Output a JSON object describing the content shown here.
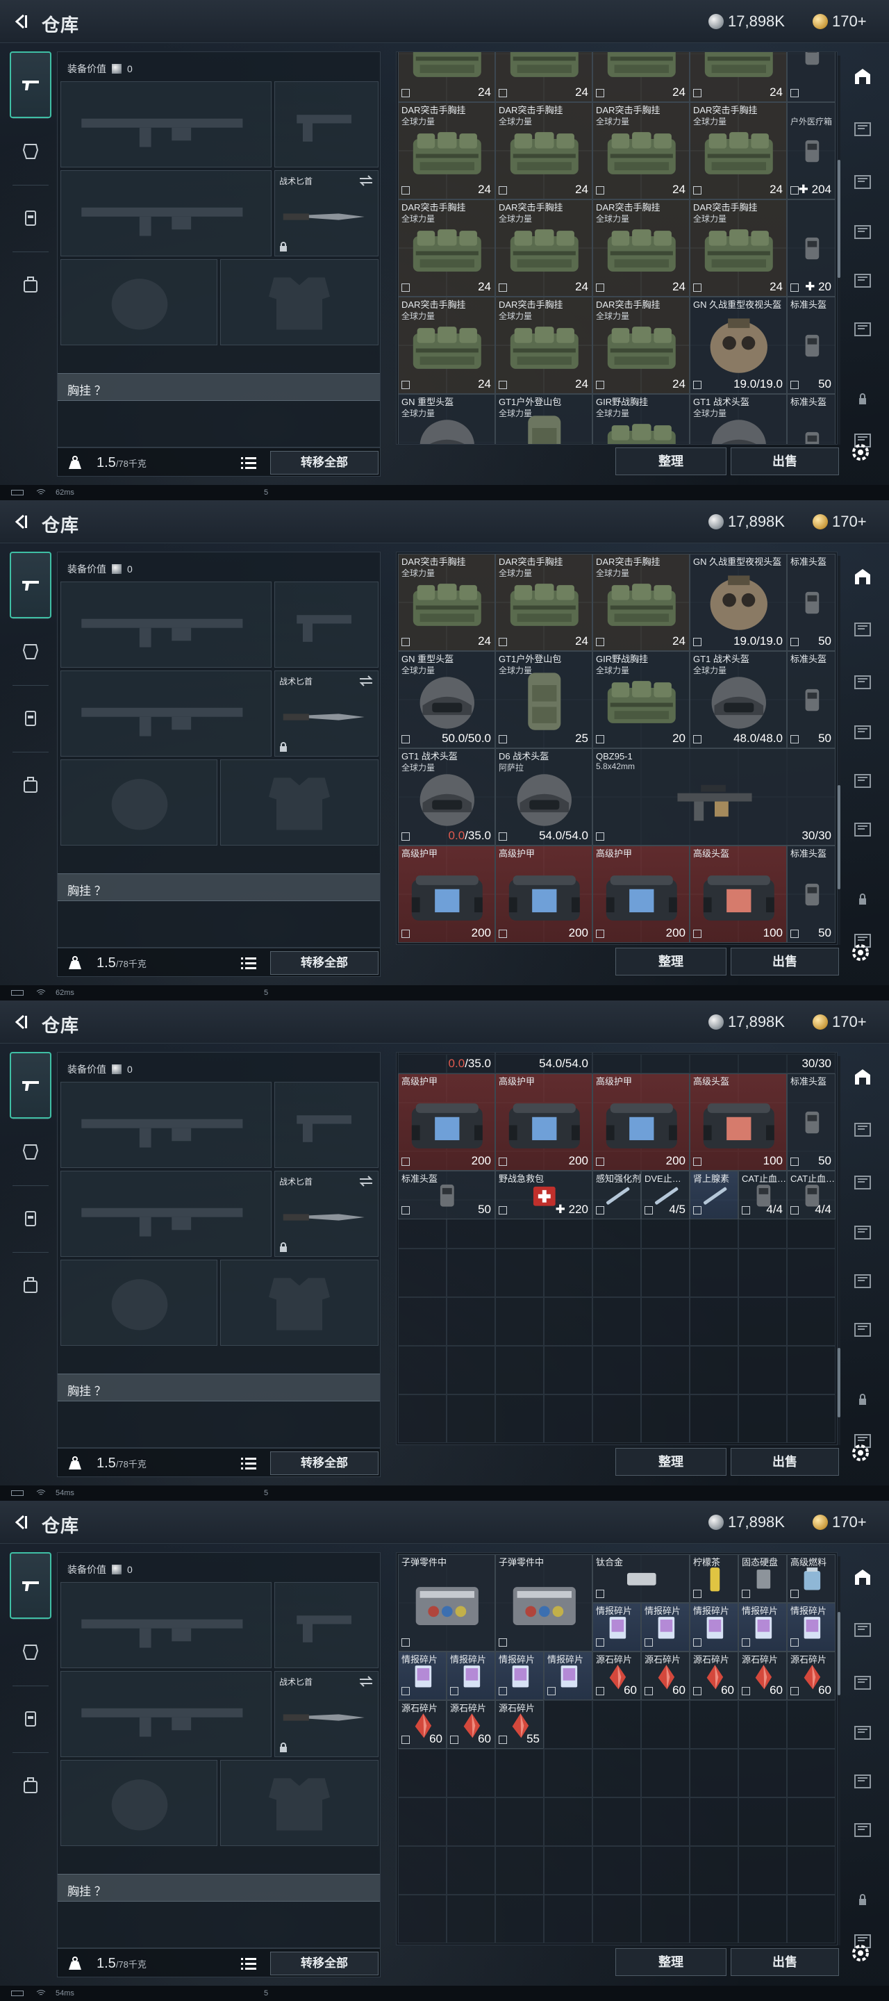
{
  "title": "仓库",
  "currency": {
    "silver": "17,898K",
    "gold": "170+"
  },
  "equip": {
    "value_label": "装备价值",
    "value": "0",
    "knife_label": "战术匕首",
    "chest_label": "胸挂 ？",
    "weight": "1.5",
    "weight_max": "/78千克",
    "transfer_label": "转移全部"
  },
  "actions": {
    "sort": "整理",
    "sell": "出售"
  },
  "status": [
    {
      "ping": "62ms",
      "mid": "5"
    },
    {
      "ping": "62ms",
      "mid": "5"
    },
    {
      "ping": "54ms",
      "mid": "5"
    },
    {
      "ping": "54ms",
      "mid": "5"
    }
  ],
  "item_labels": {
    "dar": "DAR突击手胸挂",
    "global": "全球力量",
    "medkit_out": "户外医疗箱",
    "gn_nv": "GN 久战重型夜视头盔",
    "std_helmet": "标准头盔",
    "gn_heavy": "GN 重型头盔",
    "gt1_pack": "GT1户外登山包",
    "gir_pack": "GIR野战胸挂",
    "gt1_helmet": "GT1 战术头盔",
    "d6_helmet": "D6 战术头盔",
    "arpla": "阿萨拉",
    "qbz": "QBZ95-1",
    "qbz_sub": "5.8x42mm",
    "armor_high": "高级护甲",
    "helmet_high": "高级头盔",
    "field_kit": "野战急救包",
    "sense": "感知强化剂",
    "dve": "DVE止…",
    "adrenaline": "肾上腺素",
    "cat1": "CAT止血…",
    "cat2": "CAT止血…",
    "ammo_parts": "子弹零件中",
    "titanium": "钛合金",
    "lemon": "柠檬茶",
    "cds": "固态硬盘",
    "fuel": "高级燃料",
    "intel": "情报碎片",
    "source": "源石碎片"
  },
  "item_counts": {
    "c24": "24",
    "c204": "204",
    "c20": "20",
    "c50": "50",
    "helmet_nv": "19.0/19.0",
    "helmet_gn": "50.0/50.0",
    "c25": "25",
    "helmet_gt1": "48.0/48.0",
    "helmet_gt1b_a": "0.0",
    "helmet_gt1b_b": "/35.0",
    "helmet_d6": "54.0/54.0",
    "qbz_ammo": "30/30",
    "c200": "200",
    "c100": "100",
    "c220": "220",
    "c45": "4/5",
    "c44": "4/4",
    "c60": "60",
    "c55": "55"
  }
}
